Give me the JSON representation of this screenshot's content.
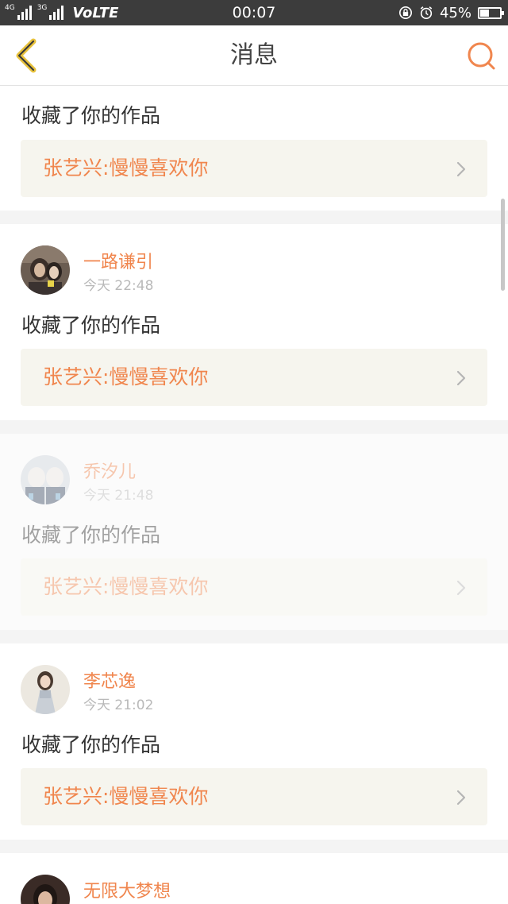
{
  "status_bar": {
    "net_left": "4G",
    "net_right": "3G",
    "volte": "VoLTE",
    "time": "00:07",
    "battery_percent_text": "45%",
    "battery_level": 0.45,
    "icons": [
      "signal-icon",
      "lock-rotation-icon",
      "alarm-icon",
      "battery-icon"
    ]
  },
  "header": {
    "title": "消息",
    "back_icon": "chevron-left-icon",
    "search_icon": "search-icon",
    "accent_color": "#f0864e",
    "back_color": "#e8c23c"
  },
  "messages": [
    {
      "username": "",
      "time": "",
      "action": "收藏了你的作品",
      "work_title": "张艺兴:慢慢喜欢你",
      "faded": false
    },
    {
      "username": "一路谦引",
      "time": "今天 22:48",
      "action": "收藏了你的作品",
      "work_title": "张艺兴:慢慢喜欢你",
      "faded": false
    },
    {
      "username": "乔汐儿",
      "time": "今天 21:48",
      "action": "收藏了你的作品",
      "work_title": "张艺兴:慢慢喜欢你",
      "faded": true
    },
    {
      "username": "李芯逸",
      "time": "今天 21:02",
      "action": "收藏了你的作品",
      "work_title": "张艺兴:慢慢喜欢你",
      "faded": false
    },
    {
      "username": "无限大梦想",
      "time": "",
      "action": "",
      "work_title": "",
      "faded": false
    }
  ]
}
